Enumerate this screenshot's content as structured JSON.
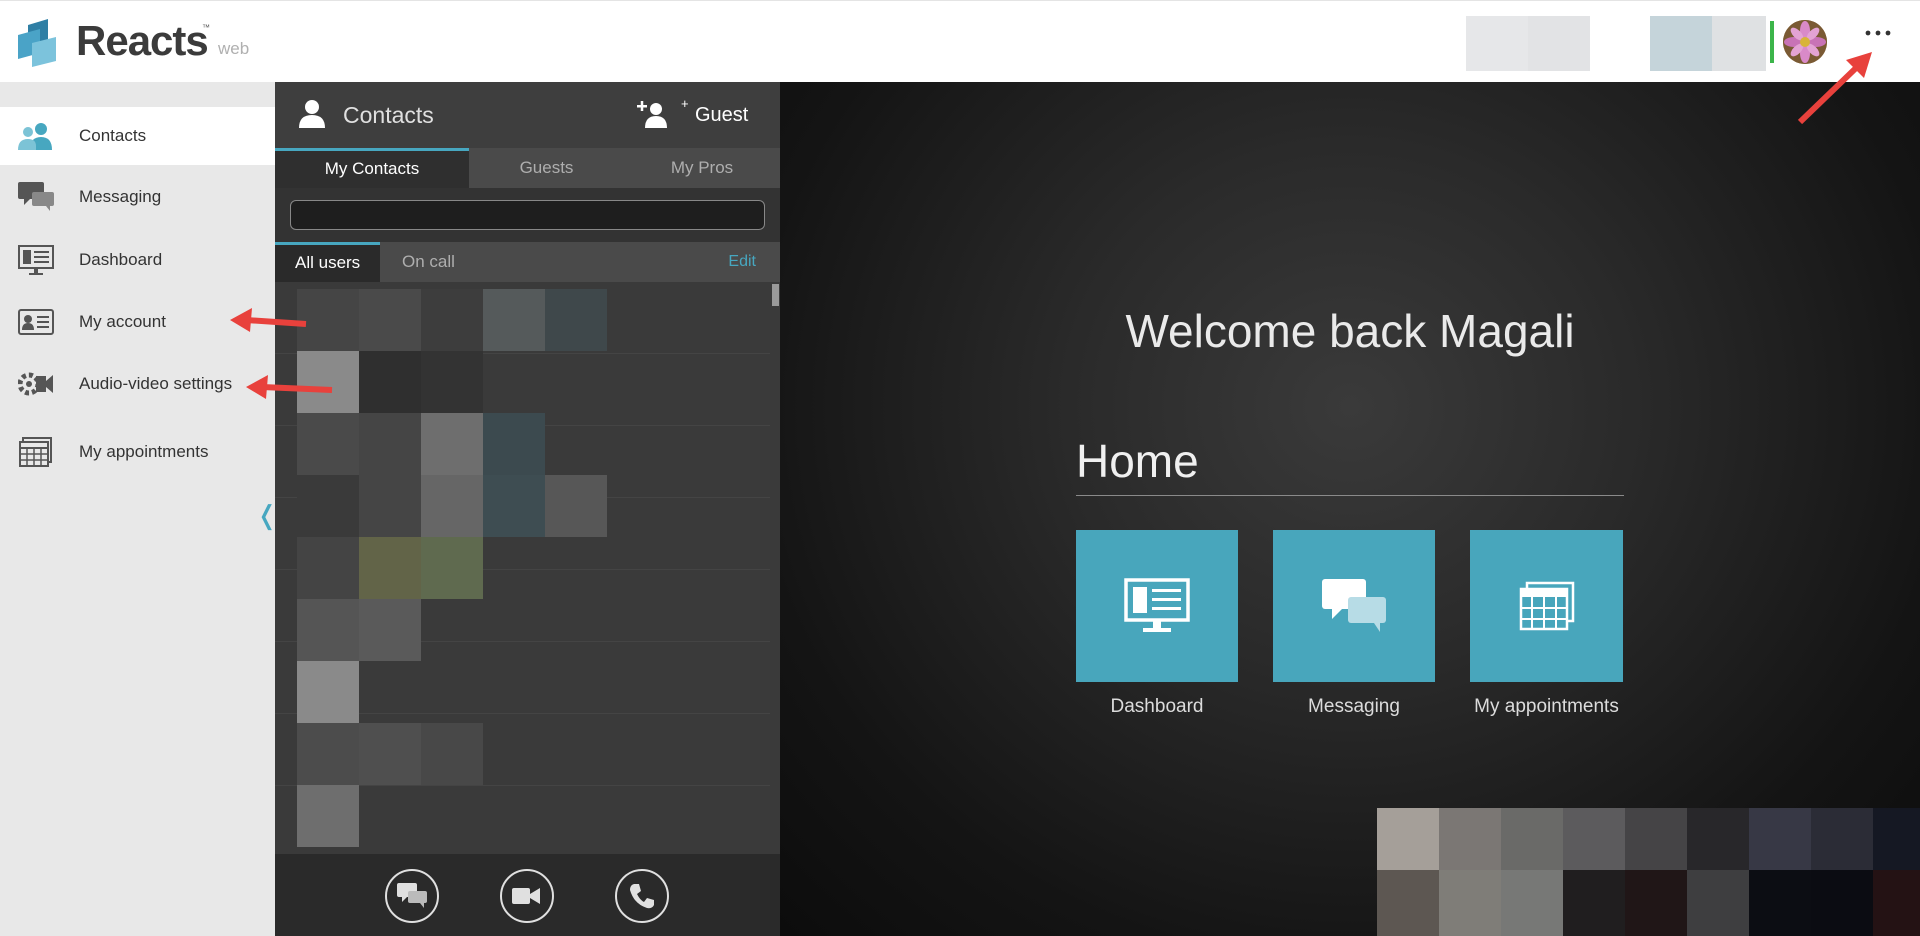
{
  "header": {
    "brand": "Reacts",
    "brand_tm": "™",
    "brand_sub": "web",
    "more_label": "···"
  },
  "sidebar": {
    "items": [
      {
        "label": "Contacts",
        "icon": "contacts-icon"
      },
      {
        "label": "Messaging",
        "icon": "chat-icon"
      },
      {
        "label": "Dashboard",
        "icon": "monitor-icon"
      },
      {
        "label": "My account",
        "icon": "id-card-icon"
      },
      {
        "label": "Audio-video settings",
        "icon": "av-settings-icon"
      },
      {
        "label": "My appointments",
        "icon": "calendar-icon"
      }
    ],
    "collapse": "❬"
  },
  "contacts_panel": {
    "title": "Contacts",
    "guest_label": "Guest",
    "tabs": [
      "My Contacts",
      "Guests",
      "My Pros"
    ],
    "search_value": "",
    "subtabs": [
      "All users",
      "On call"
    ],
    "edit_label": "Edit"
  },
  "main": {
    "welcome": "Welcome back Magali",
    "home_title": "Home",
    "tiles": [
      {
        "label": "Dashboard",
        "icon": "monitor-icon"
      },
      {
        "label": "Messaging",
        "icon": "chat-icon"
      },
      {
        "label": "My appointments",
        "icon": "calendar-icon"
      }
    ]
  },
  "colors": {
    "accent": "#47a7c0",
    "tile": "#48a6bc",
    "status": "#3cb54a",
    "annotation": "#e8413c"
  }
}
